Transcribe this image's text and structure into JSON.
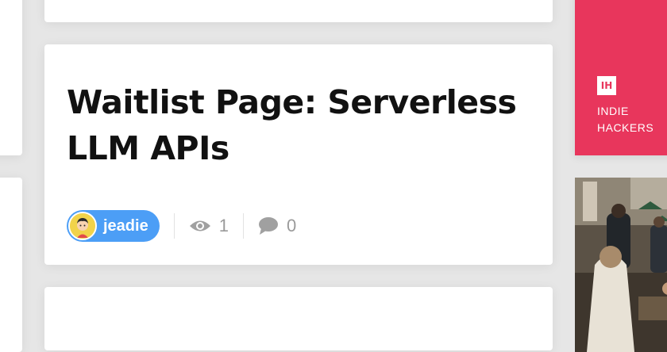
{
  "post": {
    "title": "Waitlist Page: Serverless LLM APIs",
    "author": "jeadie",
    "views": "1",
    "comments": "0"
  },
  "promo": {
    "logo": "IH",
    "line1": "INDIE",
    "line2": "HACKERS",
    "color": "#e8365c"
  },
  "icons": {
    "views": "eye-icon",
    "comments": "comment-icon"
  },
  "colors": {
    "author_pill": "#4c9ef6",
    "stat_text": "#9a9a9a"
  }
}
